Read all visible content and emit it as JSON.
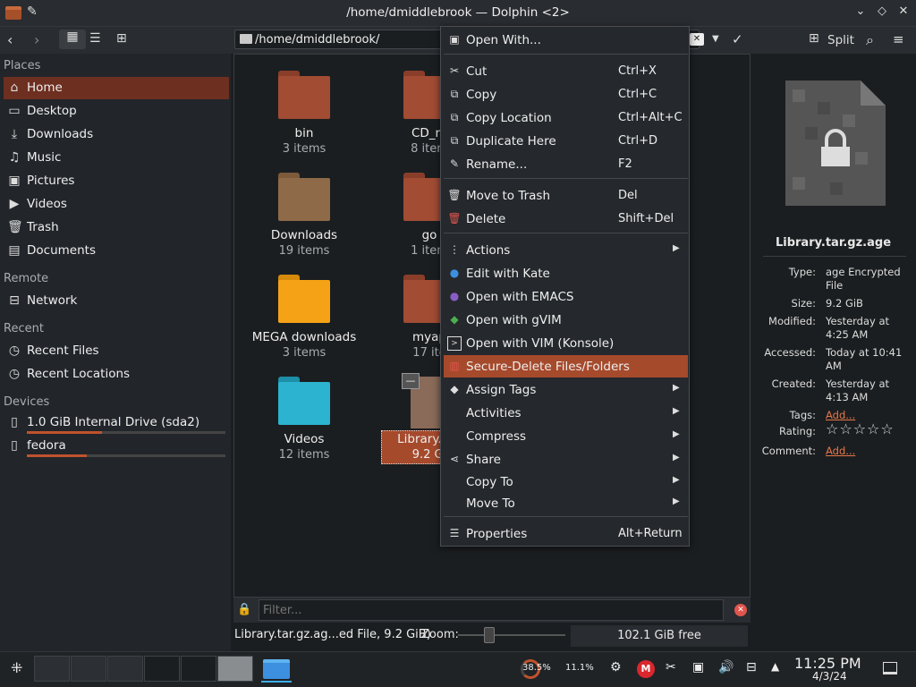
{
  "window": {
    "title": "/home/dmiddlebrook — Dolphin <2>"
  },
  "toolbar": {
    "path": "/home/dmiddlebrook/",
    "split_label": "Split"
  },
  "sidebar": {
    "places_header": "Places",
    "places": [
      {
        "label": "Home",
        "icon": "home-icon"
      },
      {
        "label": "Desktop",
        "icon": "desktop-icon"
      },
      {
        "label": "Downloads",
        "icon": "download-icon"
      },
      {
        "label": "Music",
        "icon": "music-icon"
      },
      {
        "label": "Pictures",
        "icon": "picture-icon"
      },
      {
        "label": "Videos",
        "icon": "video-icon"
      },
      {
        "label": "Trash",
        "icon": "trash-icon"
      },
      {
        "label": "Documents",
        "icon": "document-icon"
      }
    ],
    "remote_header": "Remote",
    "remote": [
      {
        "label": "Network",
        "icon": "network-icon"
      }
    ],
    "recent_header": "Recent",
    "recent": [
      {
        "label": "Recent Files"
      },
      {
        "label": "Recent Locations"
      }
    ],
    "devices_header": "Devices",
    "devices": [
      {
        "label": "1.0 GiB Internal Drive (sda2)",
        "usage": 0.38
      },
      {
        "label": "fedora",
        "usage": 0.3
      }
    ]
  },
  "files": [
    {
      "name": "bin",
      "count": "3 items"
    },
    {
      "name": "CD_ro",
      "count": "8 item"
    },
    {
      "name": "Downloads",
      "count": "19 items"
    },
    {
      "name": "go",
      "count": "1 item"
    },
    {
      "name": "MEGA downloads",
      "count": "3 items"
    },
    {
      "name": "myap",
      "count": "17 ite"
    },
    {
      "name": "Videos",
      "count": "12 items"
    },
    {
      "name": "Library.tar.",
      "count": "9.2 Gi"
    },
    {
      "name": "ents",
      "count": "ns"
    },
    {
      "name": "ry",
      "count": "ns"
    },
    {
      "name": "s",
      "count": "n"
    }
  ],
  "context_menu": [
    {
      "label": "Open With...",
      "shortcut": ""
    },
    {
      "label": "Cut",
      "shortcut": "Ctrl+X"
    },
    {
      "label": "Copy",
      "shortcut": "Ctrl+C"
    },
    {
      "label": "Copy Location",
      "shortcut": "Ctrl+Alt+C"
    },
    {
      "label": "Duplicate Here",
      "shortcut": "Ctrl+D"
    },
    {
      "label": "Rename...",
      "shortcut": "F2"
    },
    {
      "label": "Move to Trash",
      "shortcut": "Del"
    },
    {
      "label": "Delete",
      "shortcut": "Shift+Del"
    },
    {
      "label": "Actions",
      "shortcut": ""
    },
    {
      "label": "Edit with Kate",
      "shortcut": ""
    },
    {
      "label": "Open with EMACS",
      "shortcut": ""
    },
    {
      "label": "Open with gVIM",
      "shortcut": ""
    },
    {
      "label": "Open with VIM (Konsole)",
      "shortcut": ""
    },
    {
      "label": "Secure-Delete Files/Folders",
      "shortcut": ""
    },
    {
      "label": "Assign Tags",
      "shortcut": ""
    },
    {
      "label": "Activities",
      "shortcut": ""
    },
    {
      "label": "Compress",
      "shortcut": ""
    },
    {
      "label": "Share",
      "shortcut": ""
    },
    {
      "label": "Copy To",
      "shortcut": ""
    },
    {
      "label": "Move To",
      "shortcut": ""
    },
    {
      "label": "Properties",
      "shortcut": "Alt+Return"
    }
  ],
  "info": {
    "filename": "Library.tar.gz.age",
    "rows": [
      {
        "k": "Type:",
        "v": "age Encrypted File"
      },
      {
        "k": "Size:",
        "v": "9.2 GiB"
      },
      {
        "k": "Modified:",
        "v": "Yesterday at 4:25 AM"
      },
      {
        "k": "Accessed:",
        "v": "Today at 10:41 AM"
      },
      {
        "k": "Created:",
        "v": "Yesterday at 4:13 AM"
      },
      {
        "k": "Tags:",
        "v": "Add..."
      },
      {
        "k": "Rating:",
        "v": "☆☆☆☆☆"
      },
      {
        "k": "Comment:",
        "v": "Add..."
      }
    ]
  },
  "filter": {
    "placeholder": "Filter..."
  },
  "status": {
    "text": "Library.tar.gz.ag...ed File, 9.2 GiB)",
    "zoom_label": "Zoom:",
    "zoom_level": 0.24,
    "free": "102.1 GiB free"
  },
  "taskbar": {
    "cpu": "38.5%",
    "mem": "11.1%",
    "time": "11:25 PM",
    "date": "4/3/24"
  }
}
